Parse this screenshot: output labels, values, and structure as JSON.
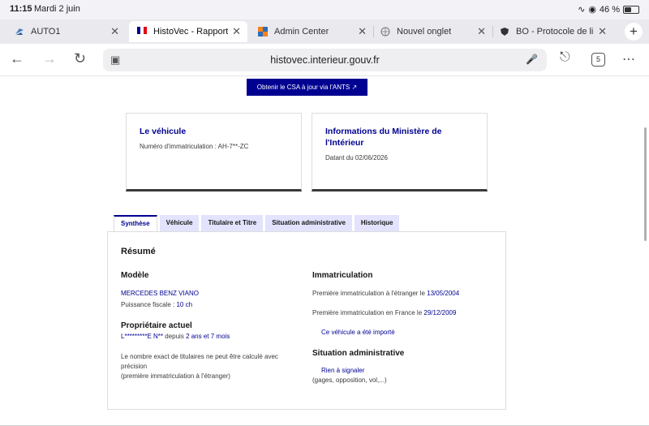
{
  "status_bar": {
    "time": "11:15",
    "date": "Mardi 2 juin",
    "battery": "46 %"
  },
  "browser_tabs": [
    {
      "title": "AUTO1",
      "favicon": "auto1-favicon",
      "active": false
    },
    {
      "title": "HistoVec - Rapport",
      "favicon": "french-flag-favicon",
      "active": true
    },
    {
      "title": "Admin Center",
      "favicon": "admin-center-favicon",
      "active": false
    },
    {
      "title": "Nouvel onglet",
      "favicon": "globe-favicon",
      "active": false
    },
    {
      "title": "BO - Protocole de li",
      "favicon": "shield-favicon",
      "active": false
    }
  ],
  "toolbar": {
    "url": "histovec.interieur.gouv.fr",
    "tab_count": "5"
  },
  "page": {
    "csa_button": "Obtenir le CSA à jour via l'ANTS",
    "vehicle_card": {
      "title": "Le véhicule",
      "plate_line": "Numéro d'immatriculation : AH-7**-ZC"
    },
    "ministry_card": {
      "title": "Informations du Ministère de l'Intérieur",
      "date_line": "Datant du 02/06/2026"
    },
    "tabs": [
      "Synthèse",
      "Véhicule",
      "Titulaire et Titre",
      "Situation administrative",
      "Historique"
    ],
    "summary": {
      "heading": "Résumé",
      "model_heading": "Modèle",
      "model_value": "MERCEDES BENZ VIANO",
      "fiscal_label": "Puissance fiscale : ",
      "fiscal_value": "10 ch",
      "owner_heading": "Propriétaire actuel",
      "owner_name": "L*********E N**",
      "owner_since_label": " depuis ",
      "owner_since_value": "2 ans et 7 mois",
      "owner_note_1": "Le nombre exact de titulaires ne peut être calculé avec",
      "owner_note_2": "précision",
      "owner_note_3": "(première immatriculation à l'étranger)",
      "reg_heading": "Immatriculation",
      "reg_foreign_label": "Première immatriculation à l'étranger le ",
      "reg_foreign_date": "13/05/2004",
      "reg_france_label": "Première immatriculation en France le ",
      "reg_france_date": "29/12/2009",
      "imported_note": "Ce véhicule a été importé",
      "admin_heading": "Situation administrative",
      "admin_value": "Rien à signaler",
      "admin_note": "(gages, opposition, vol,...)"
    }
  }
}
